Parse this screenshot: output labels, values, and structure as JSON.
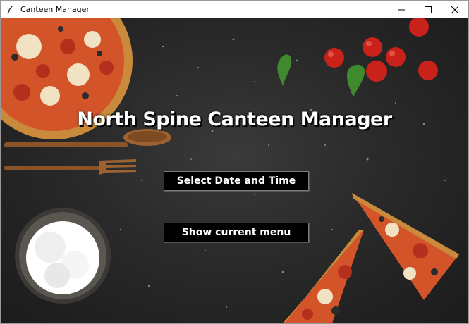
{
  "window": {
    "title": "Canteen Manager",
    "icons": {
      "app": "feather-icon",
      "minimize": "minimize-icon",
      "maximize": "maximize-icon",
      "close": "close-icon"
    }
  },
  "main": {
    "heading": "North Spine Canteen Manager",
    "buttons": {
      "select_datetime": "Select Date and Time",
      "show_menu": "Show current menu"
    }
  },
  "theme": {
    "background": "#2a2a2a",
    "button_bg": "#000000",
    "button_text": "#ffffff",
    "heading_text": "#ffffff"
  }
}
